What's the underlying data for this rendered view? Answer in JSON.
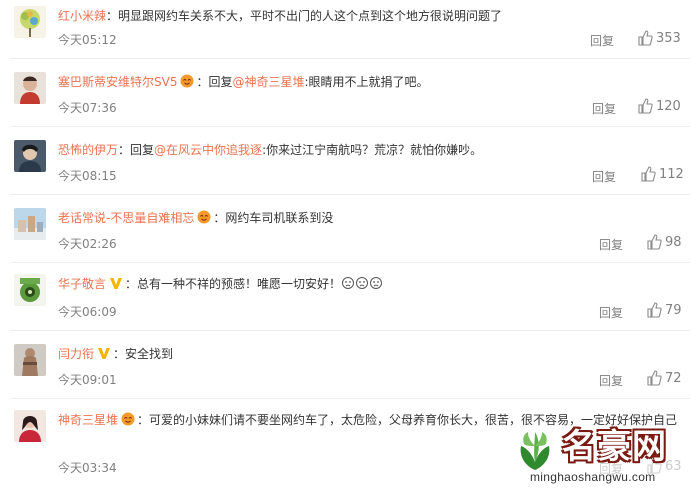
{
  "comments": [
    {
      "username": "红小米辣",
      "prefix": "",
      "mention": "",
      "text": "明显跟网约车关系不大，平时不出门的人这个点到这个地方很说明问题了",
      "time": "今天05:12",
      "reply_label": "回复",
      "likes": "353"
    },
    {
      "username": "塞巴斯蒂安维特尔SV5",
      "prefix": "回复",
      "mention": "@神奇三星堆",
      "text": ":眼睛用不上就捐了吧。",
      "time": "今天07:36",
      "reply_label": "回复",
      "likes": "120"
    },
    {
      "username": "恐怖的伊万",
      "prefix": "回复",
      "mention": "@在风云中你追我逐",
      "text": ":你来过江宁南航吗？荒凉？就怕你嫌吵。",
      "time": "今天08:15",
      "reply_label": "回复",
      "likes": "112"
    },
    {
      "username": "老话常说-不思量自难相忘",
      "prefix": "",
      "mention": "",
      "text": "网约车司机联系到没",
      "time": "今天02:26",
      "reply_label": "回复",
      "likes": "98"
    },
    {
      "username": "华子敬言",
      "prefix": "",
      "mention": "",
      "text": "总有一种不祥的预感！唯愿一切安好！",
      "time": "今天06:09",
      "reply_label": "回复",
      "likes": "79"
    },
    {
      "username": "闫力衔",
      "prefix": "",
      "mention": "",
      "text": "安全找到",
      "time": "今天09:01",
      "reply_label": "回复",
      "likes": "72"
    },
    {
      "username": "神奇三星堆",
      "prefix": "",
      "mention": "",
      "text": "可爱的小妹妹们请不要坐网约车了，太危险，父母养育你长大，很苦，很不容易，一定好好保护自己",
      "time": "今天03:34",
      "reply_label": "回复",
      "likes": "63"
    }
  ],
  "watermark": {
    "title": "名豪网",
    "url": "minghaoshangwu.com"
  },
  "colors": {
    "username": "#eb7350",
    "meta": "#808080",
    "text": "#333333",
    "separator": "#eeeeee"
  }
}
